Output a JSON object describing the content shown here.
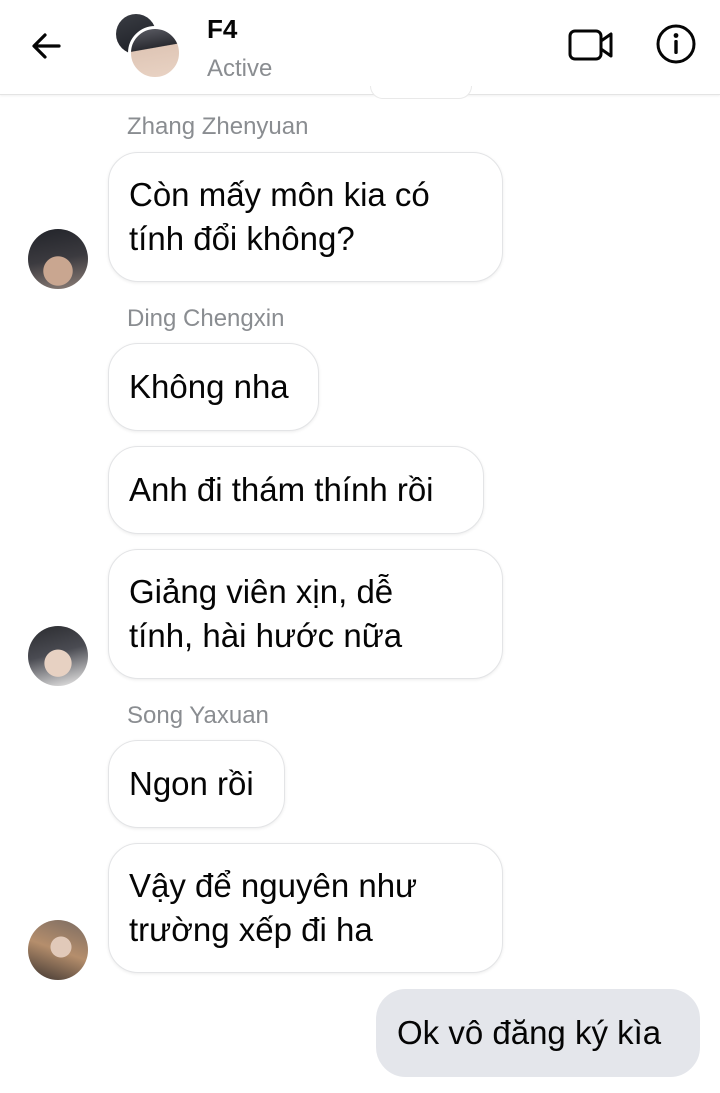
{
  "header": {
    "title": "F4",
    "status": "Active",
    "back_icon": "arrow-left-icon",
    "video_icon": "video-camera-icon",
    "info_icon": "info-icon"
  },
  "messages": [
    {
      "sender": "Zhang Zhenyuan",
      "lines": [
        "Còn mấy môn kia có",
        "tính đổi không?"
      ]
    },
    {
      "sender": "Ding Chengxin",
      "lines": [
        "Không nha"
      ]
    },
    {
      "lines": [
        "Anh đi thám thính rồi"
      ]
    },
    {
      "lines": [
        "Giảng viên xịn, dễ",
        "tính, hài hước nữa"
      ]
    },
    {
      "sender": "Song Yaxuan",
      "lines": [
        "Ngon rồi"
      ]
    },
    {
      "lines": [
        "Vậy để nguyên như",
        "trường xếp đi ha"
      ]
    },
    {
      "lines": [
        "Ok vô đăng ký kìa"
      ],
      "mine": true
    }
  ],
  "colors": {
    "incoming_bubble": "#ffffff",
    "outgoing_bubble": "#e4e6eb",
    "secondary_text": "#8a8d91"
  }
}
